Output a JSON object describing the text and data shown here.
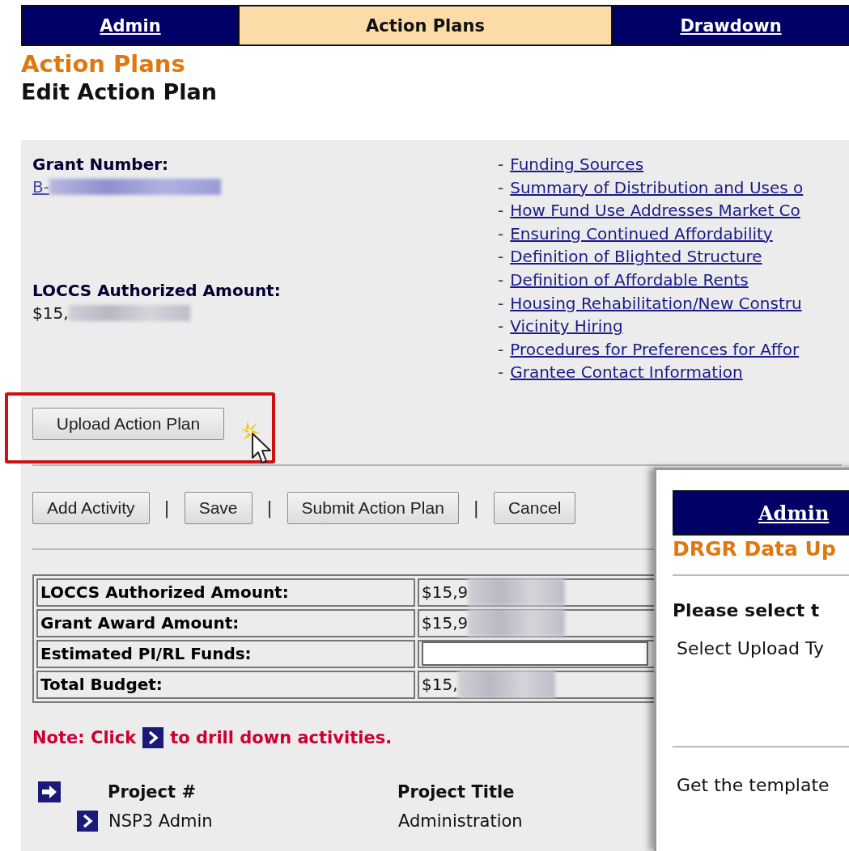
{
  "nav_tabs": [
    {
      "label": "Admin",
      "selected": false
    },
    {
      "label": "Action Plans",
      "selected": true
    },
    {
      "label": "Drawdown",
      "selected": false
    }
  ],
  "page_title": "Action Plans",
  "page_subtitle": "Edit Action Plan",
  "grant": {
    "label": "Grant Number:",
    "value": "B-",
    "redacted": true
  },
  "authorized": {
    "label": "LOCCS Authorized Amount:",
    "value": "$15,",
    "redacted": true
  },
  "section_links": [
    {
      "bullet": "-",
      "label": "Funding Sources"
    },
    {
      "bullet": "-",
      "label": "Summary of Distribution and Uses o"
    },
    {
      "bullet": "-",
      "label": "How Fund Use Addresses Market Co"
    },
    {
      "bullet": "-",
      "label": "Ensuring Continued Affordability"
    },
    {
      "bullet": "-",
      "label": "Definition of Blighted Structure"
    },
    {
      "bullet": "-",
      "label": "Definition of Affordable Rents"
    },
    {
      "bullet": "-",
      "label": "Housing Rehabilitation/New Constru"
    },
    {
      "bullet": "-",
      "label": "Vicinity Hiring"
    },
    {
      "bullet": "-",
      "label": "Procedures for Preferences for Affor"
    },
    {
      "bullet": "-",
      "label": "Grantee Contact Information"
    }
  ],
  "upload_button": "Upload Action Plan",
  "actions": [
    {
      "kind": "button",
      "label": "Add Activity"
    },
    {
      "kind": "separator",
      "label": "|"
    },
    {
      "kind": "button",
      "label": "Save"
    },
    {
      "kind": "separator",
      "label": "|"
    },
    {
      "kind": "button",
      "label": "Submit Action Plan"
    },
    {
      "kind": "separator",
      "label": "|"
    },
    {
      "kind": "button",
      "label": "Cancel"
    }
  ],
  "budget_table": [
    {
      "label": "LOCCS Authorized Amount:",
      "kind": "text",
      "value": "$15,9",
      "redacted": true
    },
    {
      "label": "Grant Award Amount:",
      "kind": "text",
      "value": "$15,9",
      "redacted": true
    },
    {
      "label": "Estimated PI/RL Funds:",
      "kind": "input"
    },
    {
      "label": "Total Budget:",
      "kind": "text",
      "value": "$15,",
      "redacted": true
    }
  ],
  "note": {
    "before": "Note: Click",
    "after": "to drill down activities."
  },
  "projects": {
    "columns": [
      "Project #",
      "Project Title"
    ],
    "rows": [
      {
        "number": "NSP3 Admin",
        "title": "Administration"
      }
    ]
  },
  "upload_dialog": {
    "tab": "Admin",
    "title": "DRGR Data Up",
    "prompt": "Please select t",
    "upload_type_label": "Select Upload Ty",
    "template_text": "Get the template"
  }
}
